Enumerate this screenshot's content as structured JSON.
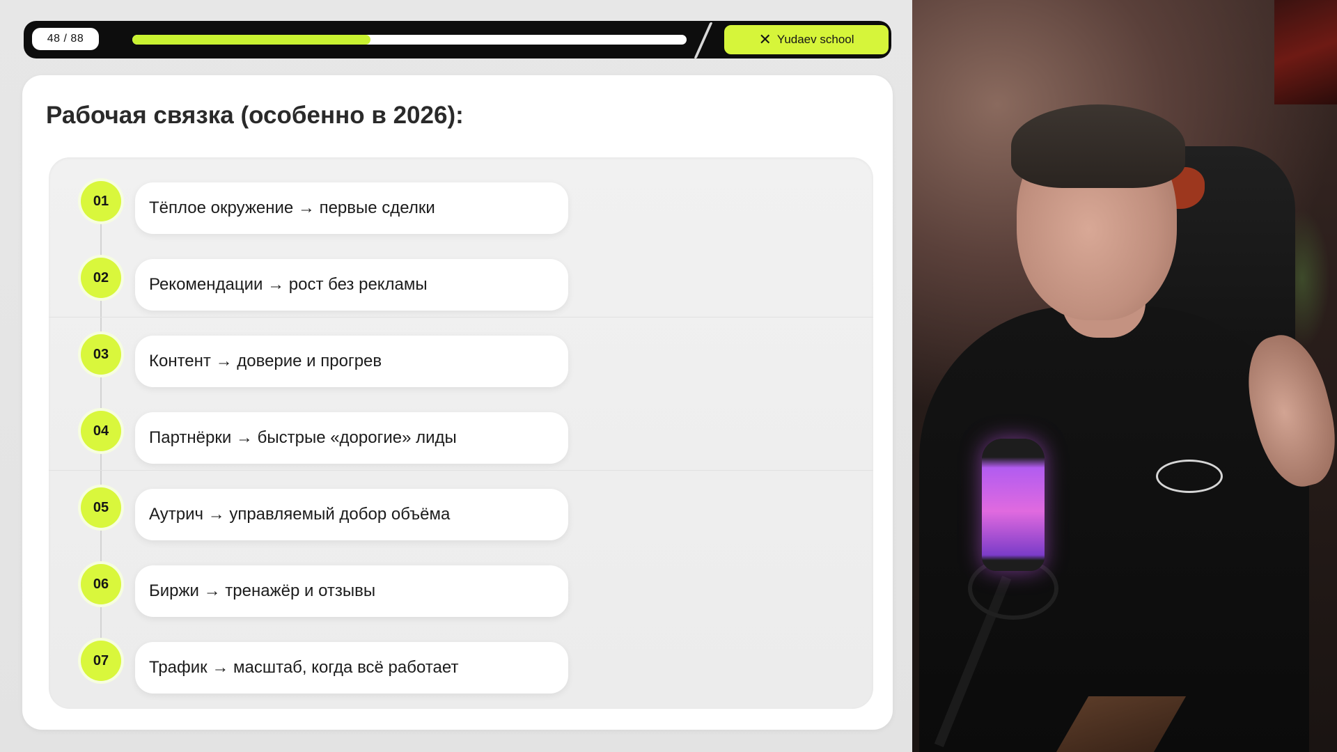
{
  "slide": {
    "counter": "48 / 88",
    "progress": 0.43,
    "brand": "Yudaev school",
    "brand_icon": "x-logo-icon",
    "title": "Рабочая связка (особенно в 2026):",
    "items": [
      {
        "num": "01",
        "text": "Тёплое окружение → первые сделки"
      },
      {
        "num": "02",
        "text": "Рекомендации → рост без рекламы"
      },
      {
        "num": "03",
        "text": "Контент → доверие и прогрев"
      },
      {
        "num": "04",
        "text": "Партнёрки → быстрые «дорогие» лиды"
      },
      {
        "num": "05",
        "text": "Аутрич → управляемый добор объёма"
      },
      {
        "num": "06",
        "text": "Биржи → тренажёр и отзывы"
      },
      {
        "num": "07",
        "text": "Трафик → масштаб, когда всё работает"
      }
    ]
  },
  "colors": {
    "accent": "#d9f73c",
    "progress_fill": "#c9f231",
    "topbar": "#0d0d0d",
    "card": "#ffffff"
  }
}
